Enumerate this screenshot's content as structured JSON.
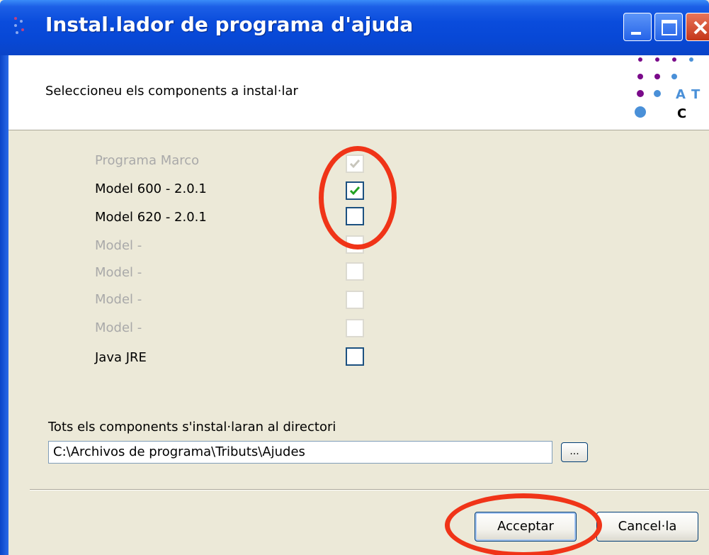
{
  "window": {
    "title": "Instal.lador de programa d'ajuda",
    "controls": {
      "minimize": "minimize-icon",
      "maximize": "maximize-icon",
      "close": "close-icon"
    }
  },
  "header": {
    "instruction": "Seleccioneu els components a instal·lar",
    "logo_letters": [
      "A",
      "T",
      "C"
    ]
  },
  "components": [
    {
      "label": "Programa Marco",
      "checked": true,
      "enabled": false
    },
    {
      "label": "Model 600 - 2.0.1",
      "checked": true,
      "enabled": true
    },
    {
      "label": "Model 620 - 2.0.1",
      "checked": false,
      "enabled": true
    },
    {
      "label": "Model -",
      "checked": false,
      "enabled": false
    },
    {
      "label": "Model -",
      "checked": false,
      "enabled": false
    },
    {
      "label": "Model -",
      "checked": false,
      "enabled": false
    },
    {
      "label": "Model -",
      "checked": false,
      "enabled": false
    },
    {
      "label": "Java JRE",
      "checked": false,
      "enabled": true
    }
  ],
  "directory": {
    "label": "Tots els components s'instal·laran al directori",
    "value": "C:\\Archivos de programa\\Tributs\\Ajudes",
    "browse_label": "..."
  },
  "buttons": {
    "accept": "Acceptar",
    "cancel": "Cancel·la"
  },
  "colors": {
    "title_bar": "#0a4cdc",
    "dialog_bg": "#ece9d8",
    "annotation": "#f03418",
    "logo_purple": "#7a0a8a",
    "logo_blue": "#4a90d8",
    "check_green": "#21a121"
  }
}
